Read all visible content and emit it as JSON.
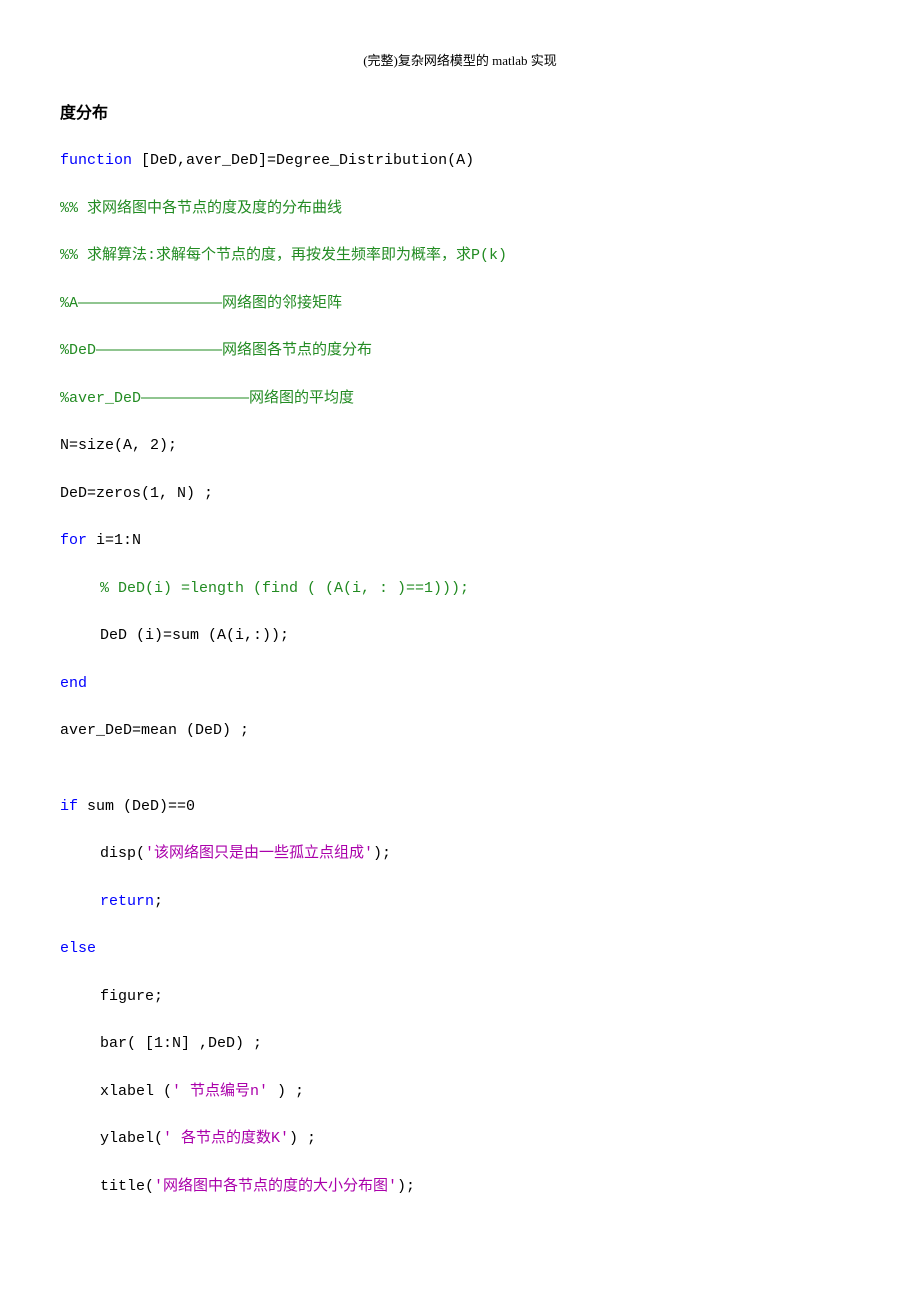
{
  "header": "(完整)复杂网络模型的 matlab 实现",
  "section_title": "度分布",
  "lines": {
    "l1_a": "function",
    "l1_b": " [DeD,aver_DeD]=Degree_Distribution(A)",
    "l2": "%% 求网络图中各节点的度及度的分布曲线",
    "l3": "%% 求解算法:求解每个节点的度，再按发生频率即为概率，求P(k)",
    "l4": "%A————————————————网络图的邻接矩阵",
    "l5": "%DeD——————————————网络图各节点的度分布",
    "l6": "%aver_DeD————————————网络图的平均度",
    "l7": "N=size(A, 2);",
    "l8": "DeD=zeros(1, N) ;",
    "l9_a": "for",
    "l9_b": " i=1:N",
    "l10": "% DeD(i) =length (find ( (A(i, : )==1)));",
    "l11": "DeD (i)=sum (A(i,:));",
    "l12": "end",
    "l13": "aver_DeD=mean (DeD) ;",
    "l14_a": "if",
    "l14_b": " sum (DeD)==0",
    "l15_a": "disp(",
    "l15_b": "'该网络图只是由一些孤立点组成'",
    "l15_c": ");",
    "l16_a": "return",
    "l16_b": ";",
    "l17": "else",
    "l18": "figure;",
    "l19": "bar( [1:N] ,DeD) ;",
    "l20_a": "xlabel (",
    "l20_b": "' 节点编号n' ",
    "l20_c": ") ;",
    "l21_a": "ylabel(",
    "l21_b": "' 各节点的度数K'",
    "l21_c": ") ;",
    "l22_a": "title(",
    "l22_b": "'网络图中各节点的度的大小分布图'",
    "l22_c": ");"
  }
}
